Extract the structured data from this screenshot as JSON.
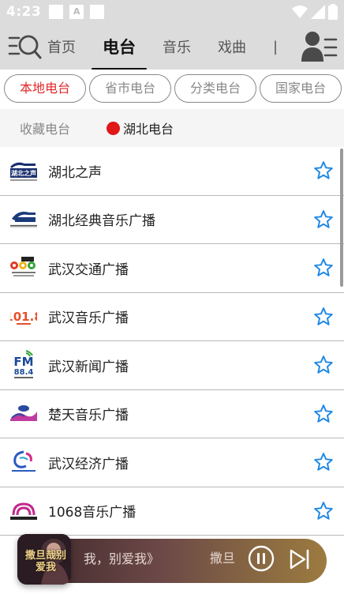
{
  "status_bar": {
    "time": "4:23"
  },
  "top_nav": {
    "tabs": [
      {
        "label": "首页",
        "active": false
      },
      {
        "label": "电台",
        "active": true
      },
      {
        "label": "音乐",
        "active": false
      },
      {
        "label": "戏曲",
        "active": false
      }
    ],
    "menu_icon": "menu-search-icon",
    "user_icon": "user-list-icon"
  },
  "category_chips": [
    {
      "label": "本地电台",
      "active": true
    },
    {
      "label": "省市电台",
      "active": false
    },
    {
      "label": "分类电台",
      "active": false
    },
    {
      "label": "国家电台",
      "active": false
    }
  ],
  "sub_tabs": {
    "favorites": "收藏电台",
    "current": "湖北电台"
  },
  "stations": [
    {
      "name": "湖北之声",
      "logo": "hubei-voice-logo"
    },
    {
      "name": "湖北经典音乐广播",
      "logo": "hubei-classic-music-logo"
    },
    {
      "name": "武汉交通广播",
      "logo": "wuhan-traffic-logo"
    },
    {
      "name": "武汉音乐广播",
      "logo": "wuhan-music-logo"
    },
    {
      "name": "武汉新闻广播",
      "logo": "wuhan-news-fm884-logo"
    },
    {
      "name": "楚天音乐广播",
      "logo": "chutian-music-logo"
    },
    {
      "name": "武汉经济广播",
      "logo": "wuhan-economy-logo"
    },
    {
      "name": "1068音乐广播",
      "logo": "music-1068-logo"
    }
  ],
  "player": {
    "track": "我，别爱我》",
    "artist": "撒旦",
    "cover_caption": "撒旦哉别爱我"
  },
  "colors": {
    "accent_red": "#e02a2a",
    "star_blue": "#1e88e5",
    "nav_bg": "#dcdcdc"
  }
}
